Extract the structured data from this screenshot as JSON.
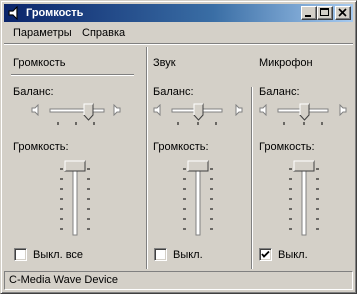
{
  "window": {
    "title": "Громкость",
    "icon": "speaker-icon",
    "controls": [
      "minimize",
      "maximize",
      "close"
    ]
  },
  "menu": {
    "items": [
      "Параметры",
      "Справка"
    ]
  },
  "columns": [
    {
      "header": "Громкость",
      "balance_label": "Баланс:",
      "volume_label": "Громкость:",
      "balance": 0.5,
      "volume": 1.0,
      "mute_label": "Выкл. все",
      "muted": false
    },
    {
      "header": "Звук",
      "balance_label": "Баланс:",
      "volume_label": "Громкость:",
      "balance": 0.5,
      "volume": 1.0,
      "mute_label": "Выкл.",
      "muted": false
    },
    {
      "header": "Микрофон",
      "balance_label": "Баланс:",
      "volume_label": "Громкость:",
      "balance": 0.5,
      "volume": 1.0,
      "mute_label": "Выкл.",
      "muted": true
    }
  ],
  "status": {
    "device": "C-Media Wave Device"
  },
  "colors": {
    "face": "#d4d0c8",
    "shadow": "#808080",
    "highlight": "#ffffff",
    "title_active": "#0a246a",
    "title_gradient_end": "#a6caf0"
  }
}
